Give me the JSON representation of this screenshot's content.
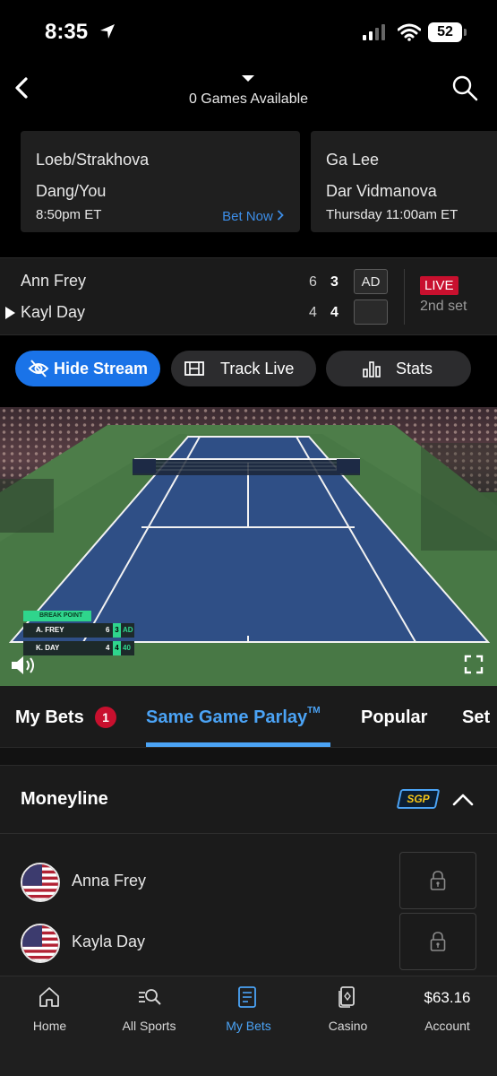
{
  "status_bar": {
    "time": "8:35",
    "battery": "52"
  },
  "header": {
    "games_available": "0 Games Available"
  },
  "upcoming_games": [
    {
      "team1": "Loeb/Strakhova",
      "team2": "Dang/You",
      "time": "8:50pm ET",
      "action": "Bet Now"
    },
    {
      "team1": "Ga Lee",
      "team2": "Dar Vidmanova",
      "time": "Thursday 11:00am ET"
    }
  ],
  "scoreboard": {
    "players": [
      {
        "name": "Ann Frey",
        "set1": "6",
        "set2": "3",
        "points": "AD",
        "serving": false
      },
      {
        "name": "Kayl Day",
        "set1": "4",
        "set2": "4",
        "points": "",
        "serving": true
      }
    ],
    "live_label": "LIVE",
    "set_label": "2nd set"
  },
  "stream_controls": {
    "hide_stream": "Hide Stream",
    "track_live": "Track Live",
    "stats": "Stats"
  },
  "video_overlay": {
    "banner": "BREAK POINT",
    "rows": [
      {
        "name": "A. FREY",
        "set1": "6",
        "set2": "3",
        "points": "AD"
      },
      {
        "name": "K. DAY",
        "set1": "4",
        "set2": "4",
        "points": "40"
      }
    ]
  },
  "tabs": {
    "items": [
      "My Bets",
      "Same Game Parlay",
      "Popular",
      "Set"
    ],
    "my_bets_count": "1",
    "trademark": "TM",
    "active": "Same Game Parlay"
  },
  "market": {
    "title": "Moneyline",
    "badge": "SGP",
    "runners": [
      {
        "name": "Anna Frey",
        "flag": "us-flag",
        "locked": true
      },
      {
        "name": "Kayla Day",
        "flag": "us-flag",
        "locked": true
      }
    ]
  },
  "bottom_nav": {
    "items": [
      "Home",
      "All Sports",
      "My Bets",
      "Casino",
      "Account"
    ],
    "balance": "$63.16",
    "active": "My Bets"
  },
  "colors": {
    "accent": "#4ba3f5",
    "live_red": "#c8102e",
    "primary_button": "#1a73e8",
    "court_blue": "#2f4f86",
    "court_green": "#4a7a45"
  }
}
